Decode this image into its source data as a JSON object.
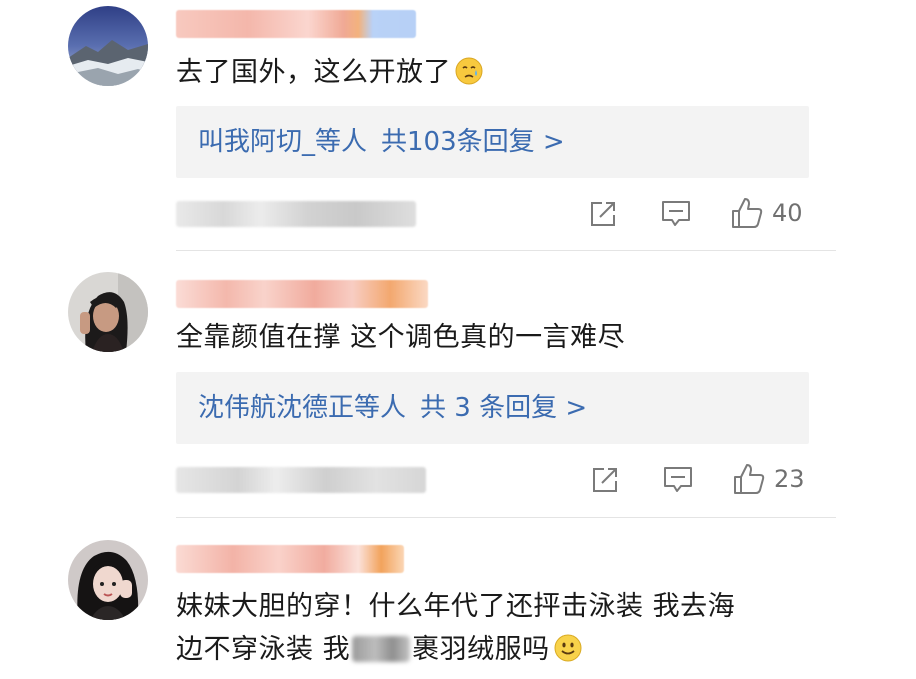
{
  "comments": [
    {
      "text": "去了国外，这么开放了",
      "emoji_icon": "sad-face-emoji",
      "reply_users": "叫我阿切_等人",
      "reply_count": "共103条回复 >",
      "like_count": "40"
    },
    {
      "text": "全靠颜值在撑 这个调色真的一言难尽",
      "reply_users": "沈伟航沈德正等人",
      "reply_count": "共 3 条回复 >",
      "like_count": "23"
    },
    {
      "text_line1": "妹妹大胆的穿！什么年代了还抨击泳装  我去海",
      "text_line2_a": "边不穿泳装  我",
      "text_line2_b": "裹羽绒服吗",
      "emoji_icon": "smiley-face-emoji"
    }
  ],
  "colors": {
    "link": "#3b6bb0",
    "reply_bg": "#f3f3f3",
    "divider": "#e4e4e4",
    "icon": "#7a7a7a"
  }
}
